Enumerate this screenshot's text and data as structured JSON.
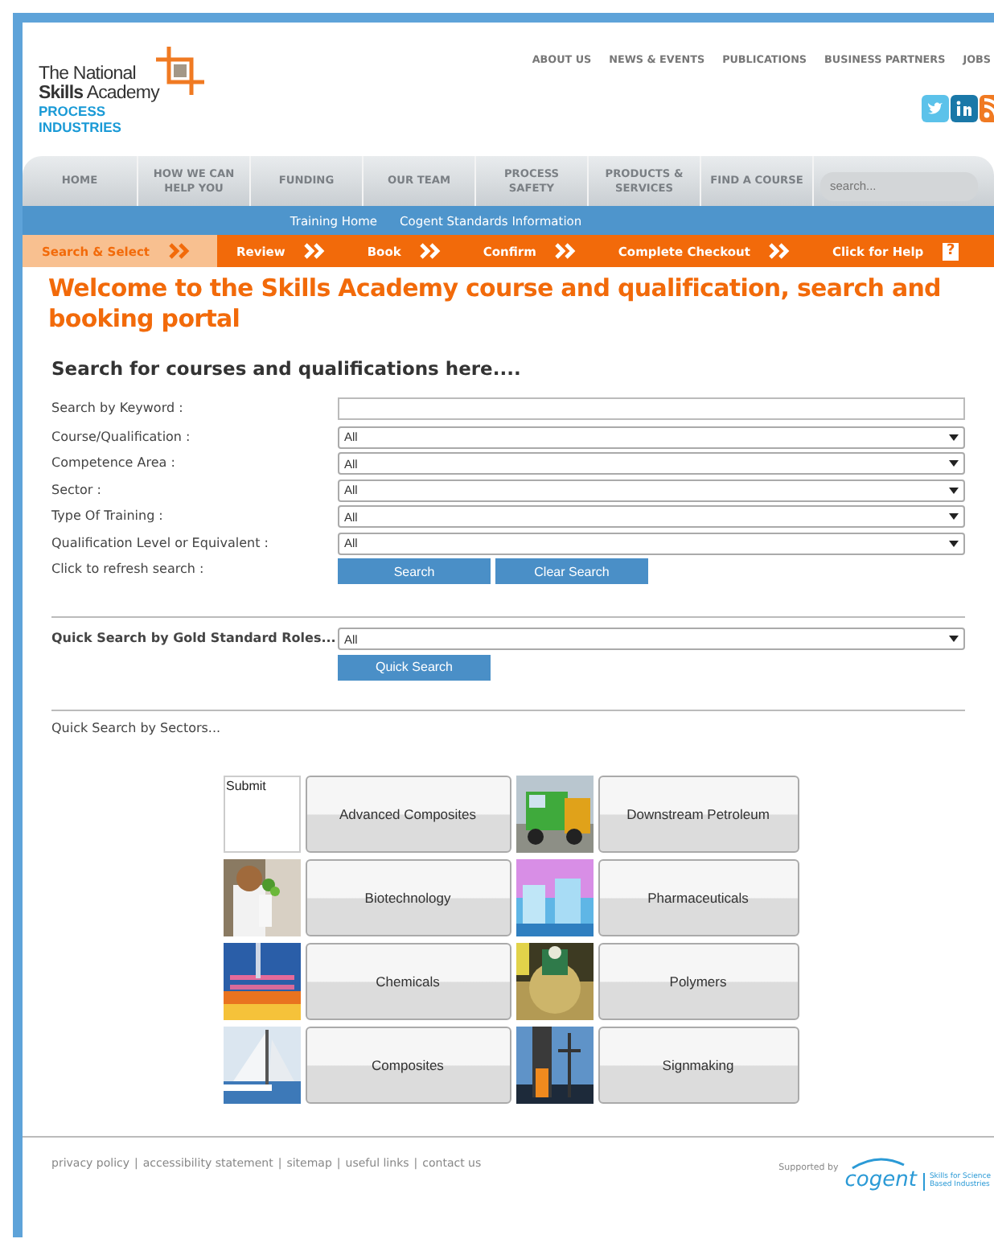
{
  "logo": {
    "line_1": "The National",
    "line_2_bold": "Skills",
    "line_2_rest": "Academy",
    "sub_1": "PROCESS",
    "sub_2": "INDUSTRIES"
  },
  "top_links": [
    {
      "label": "ABOUT US"
    },
    {
      "label": "NEWS & EVENTS"
    },
    {
      "label": "PUBLICATIONS"
    },
    {
      "label": "BUSINESS PARTNERS"
    },
    {
      "label": "JOBS"
    }
  ],
  "social": [
    {
      "kind": "twitter"
    },
    {
      "kind": "linkedin"
    },
    {
      "kind": "rss"
    }
  ],
  "nav": [
    {
      "label": "HOME"
    },
    {
      "label": "HOW WE CAN HELP YOU"
    },
    {
      "label": "FUNDING"
    },
    {
      "label": "OUR TEAM"
    },
    {
      "label": "PROCESS SAFETY"
    },
    {
      "label": "PRODUCTS & SERVICES"
    },
    {
      "label": "FIND A COURSE"
    }
  ],
  "nav_search": {
    "placeholder": "search..."
  },
  "subnav": [
    {
      "label": "Training Home"
    },
    {
      "label": "Cogent Standards Information"
    }
  ],
  "steps": [
    {
      "label": "Search & Select",
      "selected": true,
      "arrow": true
    },
    {
      "label": "Review",
      "selected": false,
      "arrow": true
    },
    {
      "label": "Book",
      "selected": false,
      "arrow": true
    },
    {
      "label": "Confirm",
      "selected": false,
      "arrow": true
    },
    {
      "label": "Complete Checkout",
      "selected": false,
      "arrow": true
    },
    {
      "label": "Click for Help",
      "selected": false,
      "arrow": false
    }
  ],
  "help_mark": "?",
  "title": "Welcome to the Skills Academy course and qualification, search and booking portal",
  "subtitle": "Search for courses and qualifications here....",
  "fields": [
    {
      "kind": "text",
      "label": "Search by Keyword :"
    },
    {
      "kind": "select",
      "label": "Course/Qualification :",
      "value": "All"
    },
    {
      "kind": "select",
      "label": "Competence Area :",
      "value": "All"
    },
    {
      "kind": "select",
      "label": "Sector :",
      "value": "All"
    },
    {
      "kind": "select",
      "label": "Type Of Training :",
      "value": "All"
    },
    {
      "kind": "select",
      "label": "Qualification Level or Equivalent :",
      "value": "All"
    }
  ],
  "refresh": {
    "label": "Click to refresh search :",
    "buttons": [
      "Search",
      "Clear Search"
    ]
  },
  "gold": {
    "label": "Quick Search by Gold Standard Roles...",
    "value": "All",
    "button": "Quick Search"
  },
  "sectors_label": "Quick Search by Sectors...",
  "sectors": [
    {
      "label": "Advanced Composites",
      "image": {
        "kind": "broken",
        "alt": "Submit"
      }
    },
    {
      "label": "Downstream Petroleum"
    },
    {
      "label": "Biotechnology"
    },
    {
      "label": "Pharmaceuticals"
    },
    {
      "label": "Chemicals"
    },
    {
      "label": "Polymers"
    },
    {
      "label": "Composites"
    },
    {
      "label": "Signmaking"
    }
  ],
  "footer": {
    "links": [
      {
        "label": "privacy policy"
      },
      {
        "label": "accessibility statement"
      },
      {
        "label": "sitemap"
      },
      {
        "label": "useful links"
      },
      {
        "label": "contact us"
      }
    ],
    "separators": [
      "|",
      "|",
      "|",
      "|"
    ],
    "supported_by": "Supported by",
    "cogent": "cogent",
    "cogent_tag_1": "Skills for Science",
    "cogent_tag_2": "Based Industries"
  }
}
